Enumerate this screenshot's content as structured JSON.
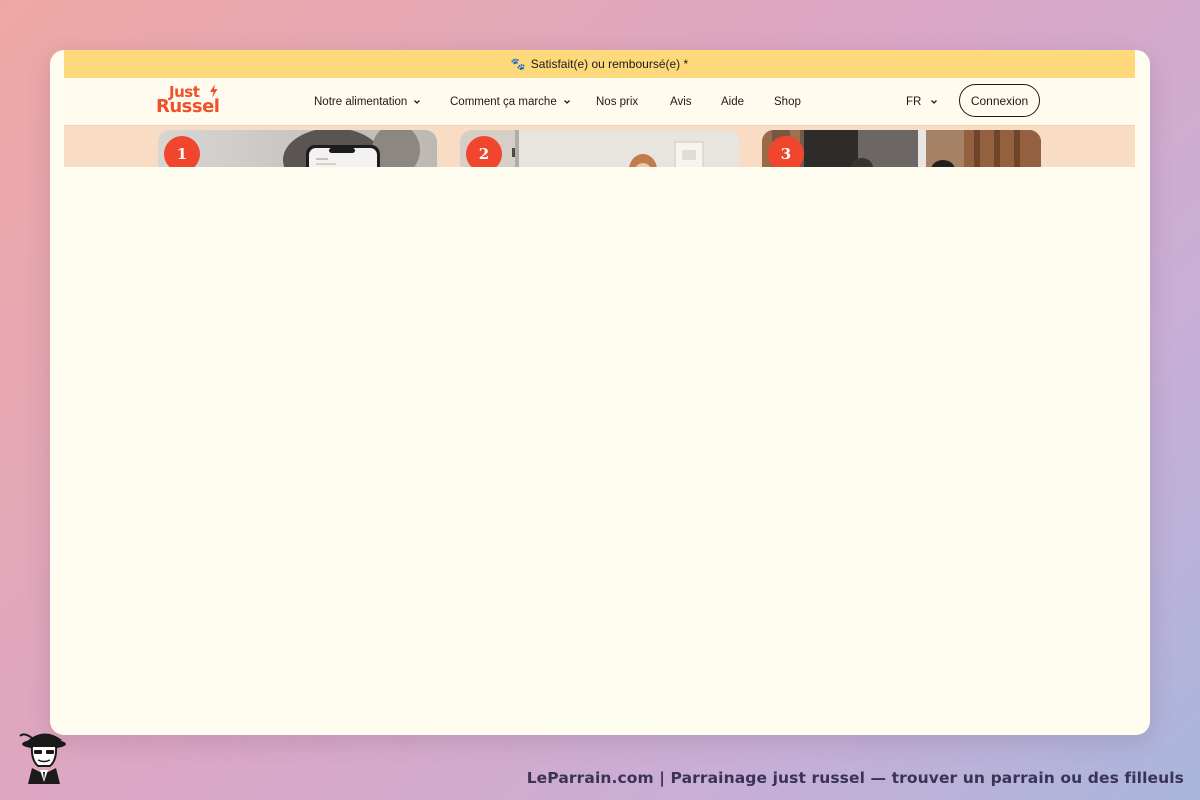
{
  "promo": {
    "icon": "paw-icon",
    "text": "Satisfait(e) ou remboursé(e) *"
  },
  "brand": {
    "line1": "Just",
    "line2": "Russel",
    "color": "#f0502c"
  },
  "nav": {
    "items": [
      {
        "label": "Notre alimentation",
        "dropdown": true
      },
      {
        "label": "Comment ça marche",
        "dropdown": true
      },
      {
        "label": "Nos prix",
        "dropdown": false
      },
      {
        "label": "Avis",
        "dropdown": false
      },
      {
        "label": "Aide",
        "dropdown": false
      },
      {
        "label": "Shop",
        "dropdown": false
      }
    ],
    "language": "FR",
    "login_label": "Connexion"
  },
  "steps": [
    {
      "number": "1"
    },
    {
      "number": "2"
    },
    {
      "number": "3"
    }
  ],
  "colors": {
    "promo_bg": "#fdd97c",
    "accent": "#f0462d",
    "page_bg": "#fffdf0"
  },
  "footer_caption": "LeParrain.com | Parrainage just russel — trouver un parrain ou des filleuls"
}
